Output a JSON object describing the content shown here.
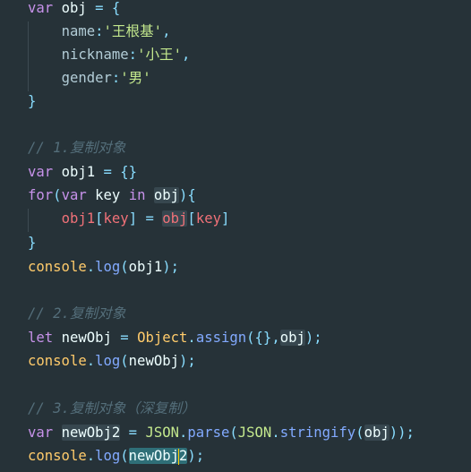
{
  "code": {
    "l1": {
      "kw": "var",
      "name": "obj",
      "eq": " = ",
      "brace": "{"
    },
    "l2": {
      "key": "name",
      "colon": ":",
      "str": "'王根基'",
      "comma": ","
    },
    "l3": {
      "key": "nickname",
      "colon": ":",
      "str": "'小王'",
      "comma": ","
    },
    "l4": {
      "key": "gender",
      "colon": ":",
      "str": "'男'"
    },
    "l5": {
      "brace": "}"
    },
    "c1": "// 1.复制对象",
    "l7": {
      "kw": "var",
      "name": "obj1",
      "eq": " = ",
      "braces": "{}"
    },
    "l8": {
      "kw_for": "for",
      "paren_open": "(",
      "kw_var": "var",
      "key": "key",
      "kw_in": "in",
      "obj": "obj",
      "paren_close": ")",
      "brace": "{"
    },
    "l9": {
      "obj1": "obj1",
      "b1": "[",
      "key1": "key",
      "b2": "]",
      "eq": " = ",
      "obj": "obj",
      "b3": "[",
      "key2": "key",
      "b4": "]"
    },
    "l10": {
      "brace": "}"
    },
    "l11": {
      "console": "console",
      "dot": ".",
      "log": "log",
      "po": "(",
      "arg": "obj1",
      "pc": ");"
    },
    "c2": "// 2.复制对象",
    "l13": {
      "kw": "let",
      "name": "newObj",
      "eq": " = ",
      "cls": "Object",
      "dot": ".",
      "fn": "assign",
      "po": "(",
      "braces": "{}",
      "comma": ",",
      "arg": "obj",
      "pc": ");"
    },
    "l14": {
      "console": "console",
      "dot": ".",
      "log": "log",
      "po": "(",
      "arg": "newObj",
      "pc": ");"
    },
    "c3": "// 3.复制对象（深复制）",
    "l16": {
      "kw": "var",
      "name": "newObj2",
      "eq": " = ",
      "json1": "JSON",
      "dot1": ".",
      "parse": "parse",
      "po1": "(",
      "json2": "JSON",
      "dot2": ".",
      "stringify": "stringify",
      "po2": "(",
      "arg": "obj",
      "pc": "));"
    },
    "l17": {
      "console": "console",
      "dot": ".",
      "log": "log",
      "po": "(",
      "arg_a": "newObj",
      "arg_b": "2",
      "pc": ");"
    }
  }
}
